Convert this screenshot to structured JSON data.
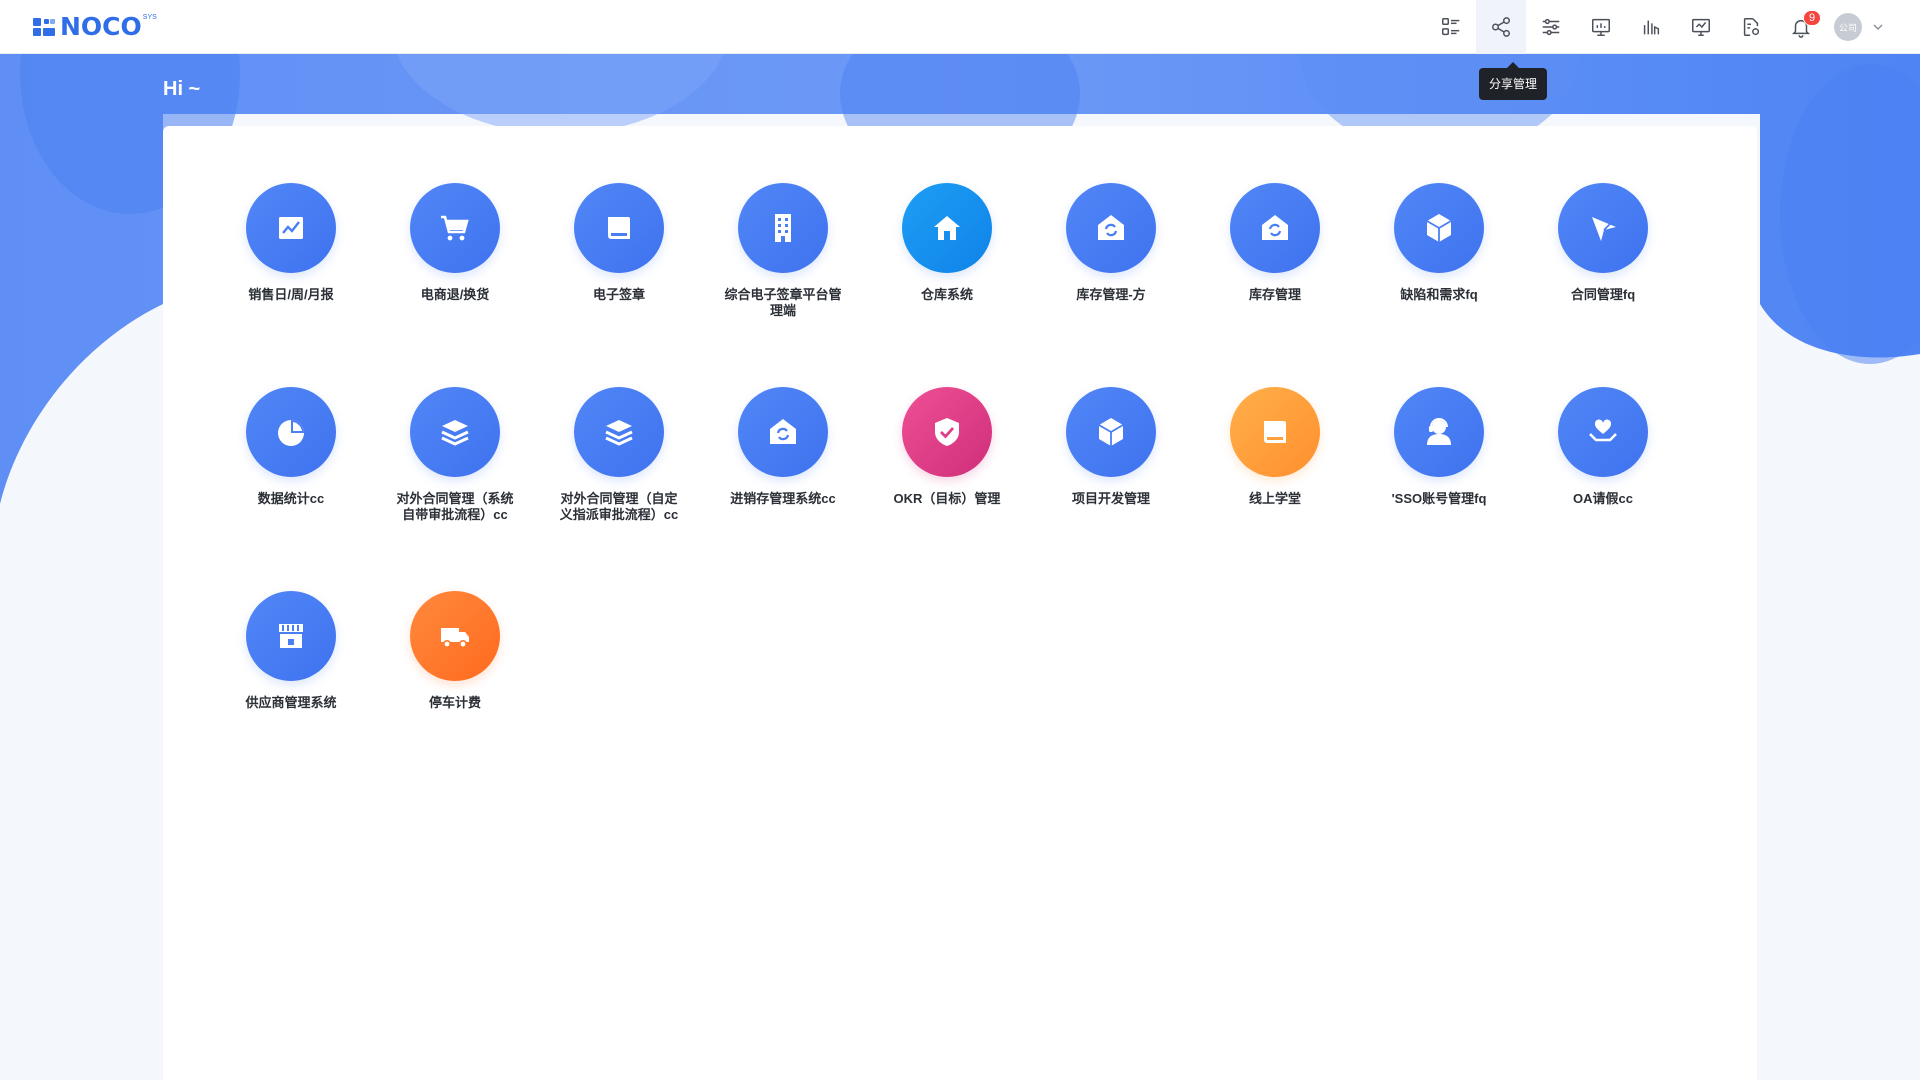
{
  "header": {
    "logo_text": "NOCO",
    "logo_sup": "SYS",
    "tools": [
      {
        "name": "list-view-icon"
      },
      {
        "name": "share-icon"
      },
      {
        "name": "settings-sliders-icon"
      },
      {
        "name": "presentation-chart-icon"
      },
      {
        "name": "bar-chart-icon"
      },
      {
        "name": "monitor-check-icon"
      },
      {
        "name": "document-settings-icon"
      },
      {
        "name": "bell-icon"
      }
    ],
    "notification_count": "9",
    "avatar_text": "公司",
    "tooltip": "分享管理"
  },
  "greeting": "Hi ~",
  "apps": [
    {
      "label": "销售日/周/月报",
      "icon": "line-chart-icon",
      "color": "#4a7ff4"
    },
    {
      "label": "电商退/换货",
      "icon": "cart-icon",
      "color": "#4a7ff4"
    },
    {
      "label": "电子签章",
      "icon": "book-icon",
      "color": "#4a7ff4"
    },
    {
      "label": "综合电子签章平台管理端",
      "icon": "building-icon",
      "color": "#4a7ff4"
    },
    {
      "label": "仓库系统",
      "icon": "home-icon",
      "color": "#168fee"
    },
    {
      "label": "库存管理-方",
      "icon": "warehouse-sync-icon",
      "color": "#4a7ff4"
    },
    {
      "label": "库存管理",
      "icon": "warehouse-sync-icon",
      "color": "#4a7ff4"
    },
    {
      "label": "缺陷和需求fq",
      "icon": "box-icon",
      "color": "#4a7ff4"
    },
    {
      "label": "合同管理fq",
      "icon": "send-icon",
      "color": "#4a7ff4"
    },
    {
      "label": "数据统计cc",
      "icon": "pie-chart-icon",
      "color": "#4a7ff4"
    },
    {
      "label": "对外合同管理（系统自带审批流程）cc",
      "icon": "layers-icon",
      "color": "#4a7ff4"
    },
    {
      "label": "对外合同管理（自定义指派审批流程）cc",
      "icon": "layers-icon",
      "color": "#4a7ff4"
    },
    {
      "label": "进销存管理系统cc",
      "icon": "warehouse-sync-icon",
      "color": "#4a7ff4"
    },
    {
      "label": "OKR（目标）管理",
      "icon": "shield-check-icon",
      "color": "#de3d88"
    },
    {
      "label": "项目开发管理",
      "icon": "box-icon",
      "color": "#4a7ff4"
    },
    {
      "label": "线上学堂",
      "icon": "book-icon",
      "color": "#ffa03c"
    },
    {
      "label": "'SSO账号管理fq",
      "icon": "support-agent-icon",
      "color": "#4a7ff4"
    },
    {
      "label": "OA请假cc",
      "icon": "heart-hand-icon",
      "color": "#4a7ff4"
    },
    {
      "label": "供应商管理系统",
      "icon": "store-icon",
      "color": "#4a7ff4"
    },
    {
      "label": "停车计费",
      "icon": "truck-icon",
      "color": "#ff7a2b"
    }
  ]
}
